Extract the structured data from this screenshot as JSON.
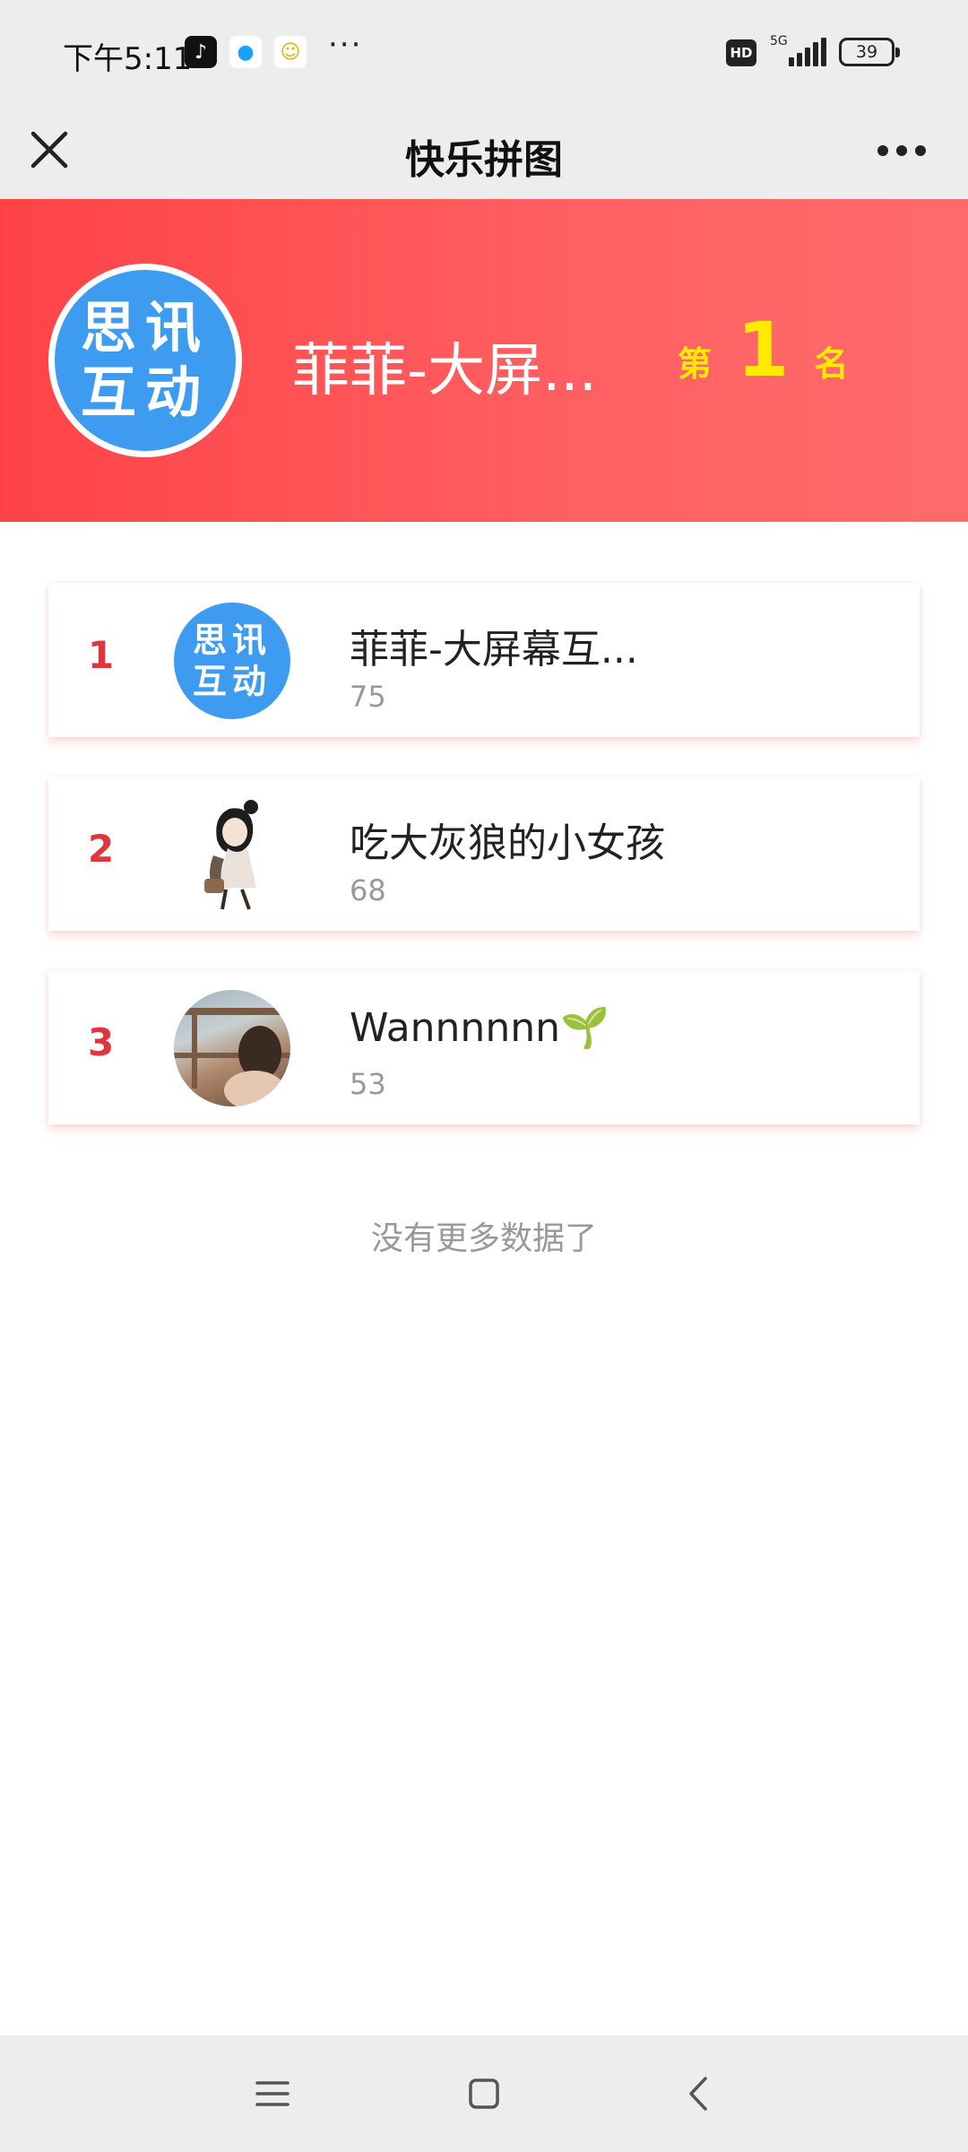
{
  "status_bar": {
    "time": "下午5:11",
    "more": "···",
    "hd": "HD",
    "network": "5G",
    "battery": "39",
    "app_icons": [
      "tiktok-icon",
      "chat-bubble-icon",
      "bee-icon"
    ]
  },
  "nav": {
    "title": "快乐拼图",
    "close_icon": "close-icon",
    "more_icon": "more-icon"
  },
  "banner": {
    "avatar_logo": [
      "思讯",
      "互动"
    ],
    "name": "菲菲-大屏...",
    "rank_prefix": "第",
    "rank": "1",
    "rank_suffix": "名"
  },
  "ranking": [
    {
      "rank": "1",
      "name": "菲菲-大屏幕互...",
      "score": "75",
      "avatar_logo": [
        "思讯",
        "互动"
      ]
    },
    {
      "rank": "2",
      "name": "吃大灰狼的小女孩",
      "score": "68"
    },
    {
      "rank": "3",
      "name": "Wannnnnn🌱",
      "score": "53"
    }
  ],
  "footer_text": "没有更多数据了",
  "colors": {
    "accent_red": "#e0353a",
    "banner_start": "#ff4347",
    "banner_end": "#ff6b6d",
    "rank_yellow": "#ffea00",
    "logo_blue": "#3d9bf0"
  }
}
